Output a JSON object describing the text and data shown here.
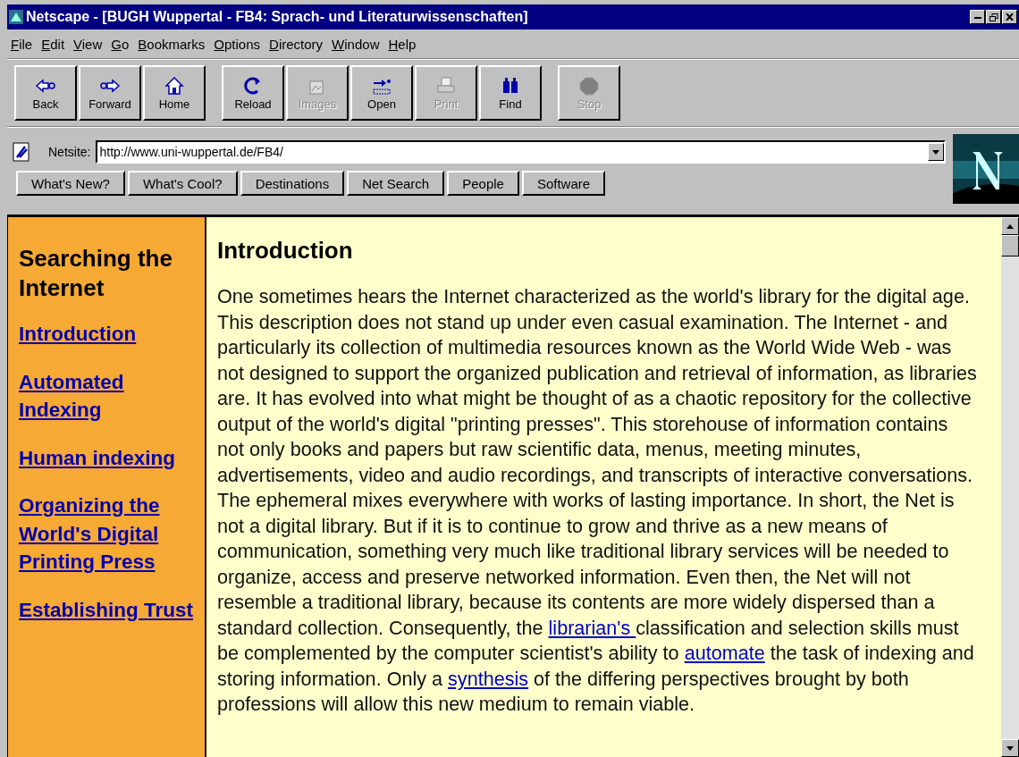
{
  "window": {
    "title": "Netscape - [BUGH Wuppertal - FB4: Sprach- und Literaturwissenschaften]"
  },
  "menu": [
    "File",
    "Edit",
    "View",
    "Go",
    "Bookmarks",
    "Options",
    "Directory",
    "Window",
    "Help"
  ],
  "toolbar": [
    [
      {
        "label": "Back",
        "disabled": false
      },
      {
        "label": "Forward",
        "disabled": false
      },
      {
        "label": "Home",
        "disabled": false
      }
    ],
    [
      {
        "label": "Reload",
        "disabled": false
      },
      {
        "label": "Images",
        "disabled": true
      },
      {
        "label": "Open",
        "disabled": false
      },
      {
        "label": "Print",
        "disabled": true
      },
      {
        "label": "Find",
        "disabled": false
      }
    ],
    [
      {
        "label": "Stop",
        "disabled": true
      }
    ]
  ],
  "location": {
    "label": "Netsite:",
    "value": "http://www.uni-wuppertal.de/FB4/"
  },
  "directory_buttons": [
    "What's New?",
    "What's Cool?",
    "Destinations",
    "Net Search",
    "People",
    "Software"
  ],
  "sidebar": {
    "title": "Searching the Internet",
    "links": [
      "Introduction",
      "Automated Indexing",
      "Human indexing",
      "Organizing the World's Digital Printing Press",
      "Establishing Trust"
    ]
  },
  "article": {
    "heading": "Introduction",
    "paragraph": [
      {
        "text": "One sometimes hears the Internet characterized as the world's library for the digital age. This description does not stand up under even casual examination. The Internet - and particularly its collection of multimedia resources known as the World Wide Web - was not designed to support the organized publication and retrieval of information, as libraries are. It has evolved into what might be thought of as a chaotic repository for the collective output of the world's digital \"printing presses\". This storehouse of information contains not only books and papers but raw scientific data, menus, meeting minutes, advertisements, video and audio recordings, and transcripts of interactive conversations. The ephemeral mixes everywhere with works of lasting importance. In short, the Net is not a digital library. But if it is to continue to grow and thrive as a new means of communication, something very much like traditional library services will be needed to organize, access and preserve networked information. Even then, the Net will not resemble a traditional library, because its contents are more widely dispersed than a standard collection. Consequently, the ",
        "link": false
      },
      {
        "text": "librarian's ",
        "link": true
      },
      {
        "text": "classification and selection skills must be complemented by the computer scientist's ability to ",
        "link": false
      },
      {
        "text": "automate",
        "link": true
      },
      {
        "text": " the task of indexing and storing information. Only a ",
        "link": false
      },
      {
        "text": "synthesis",
        "link": true
      },
      {
        "text": " of the differing perspectives brought by both professions will allow this new medium to remain viable.",
        "link": false
      }
    ]
  }
}
